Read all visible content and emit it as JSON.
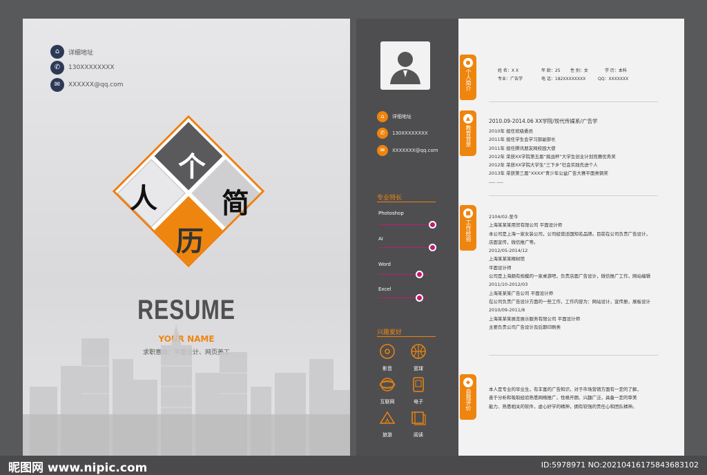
{
  "cover": {
    "contacts": [
      {
        "icon": "home-icon",
        "text": "详细地址"
      },
      {
        "icon": "phone-icon",
        "text": "130XXXXXXXX"
      },
      {
        "icon": "mail-icon",
        "text": "XXXXXX@qq.com"
      }
    ],
    "characters": [
      "个",
      "人",
      "简",
      "历"
    ],
    "resume": "RESUME",
    "your_name": "YOUR NAME",
    "intent": "求职意向：平面设计、网页美工"
  },
  "sidebar": {
    "contacts": [
      {
        "icon": "home-icon",
        "text": "详细地址"
      },
      {
        "icon": "phone-icon",
        "text": "130XXXXXXXX"
      },
      {
        "icon": "mail-icon",
        "text": "XXXXXXX@qq.com"
      }
    ],
    "skills_title": "专业特长",
    "skills": [
      {
        "name": "Photoshop",
        "level": 0.82
      },
      {
        "name": "AI",
        "level": 0.82
      },
      {
        "name": "Word",
        "level": 0.62
      },
      {
        "name": "Excel",
        "level": 0.62
      }
    ],
    "hobbies_title": "兴趣爱好",
    "hobbies": [
      {
        "icon": "music-disc-icon",
        "label": "影音"
      },
      {
        "icon": "basketball-icon",
        "label": "篮球"
      },
      {
        "icon": "internet-icon",
        "label": "互联网"
      },
      {
        "icon": "phone-device-icon",
        "label": "电子"
      },
      {
        "icon": "tent-icon",
        "label": "旅游"
      },
      {
        "icon": "book-icon",
        "label": "阅读"
      }
    ]
  },
  "tabs": {
    "profile": "个人简介",
    "education": "教育背景",
    "work": "工作经验",
    "self": "自我评价"
  },
  "profile": {
    "line1": [
      {
        "label": "姓  名：X  X"
      },
      {
        "label": "年  龄：25"
      },
      {
        "label": "性  别：女"
      },
      {
        "label": "学  历：本科"
      }
    ],
    "line2": [
      {
        "label": "专业：广告学"
      },
      {
        "label": "电  话：182XXXXXXXX"
      },
      {
        "label": "QQ：XXXXXXX"
      }
    ]
  },
  "education": {
    "header": "2010.09-2014.06      XX学院/现代传媒系/广告学",
    "lines": [
      "2010年    担任班级委员",
      "2011年    担任学生会学习部副部长",
      "2011年    担任腾讯朋友网校园大使",
      "2012年    荣获XX学院第五届“挑战杯”大学生创业计划竞赛优秀奖",
      "2012年    荣获XX学院大学生“三下乡”社会实践先进个人",
      "2013年    荣获第三届“XXXX”青少年公益广告大赛平面类铜奖",
      "---- ----"
    ]
  },
  "work": {
    "lines": [
      "2104/02-至今",
      "上海某某某用贸有限公司   平面设计师",
      "本公司是上海一家女装公司，公司经营适国知名品牌。目前在公司负责广告设计，",
      "店面宣传，微信推广等。",
      "2012/05-2014/12",
      "上海某某某椰树馆",
      "平面设计师",
      "公司是上海颇有规模的一家桌游吧，负责店面广告设计，微信推广工作，网站编辑",
      "2011/10-2012/03",
      "上海某某某广告公司   平面设计师",
      "在公司负责广告设计方面的一些工作，工作内容为：网站设计，宣传册，展板设计",
      "2010/09-2011/8",
      "上海某某某展览展示服务有限公司   平面设计师",
      "主要负责公司广告设计及后期印刷类"
    ]
  },
  "self": {
    "lines": [
      "本人是专业的毕业生，有丰富的广告知识，对于市场营销方面有一定的了解，",
      "善于分析和吸取经验熟悉网络推广，性格开朗、兴趣广泛，具备一定的审美",
      "能力、熟悉相关的软件，虚心好学的精神，拥有较强的责任心和团队精神。"
    ]
  },
  "watermark": {
    "left": "昵图网 www.nipic.com",
    "right": "ID:5978971 NO:20210416175843683102"
  },
  "colors": {
    "accent": "#ee850e",
    "dark": "#4e4e50",
    "skill": "#c21a72"
  }
}
